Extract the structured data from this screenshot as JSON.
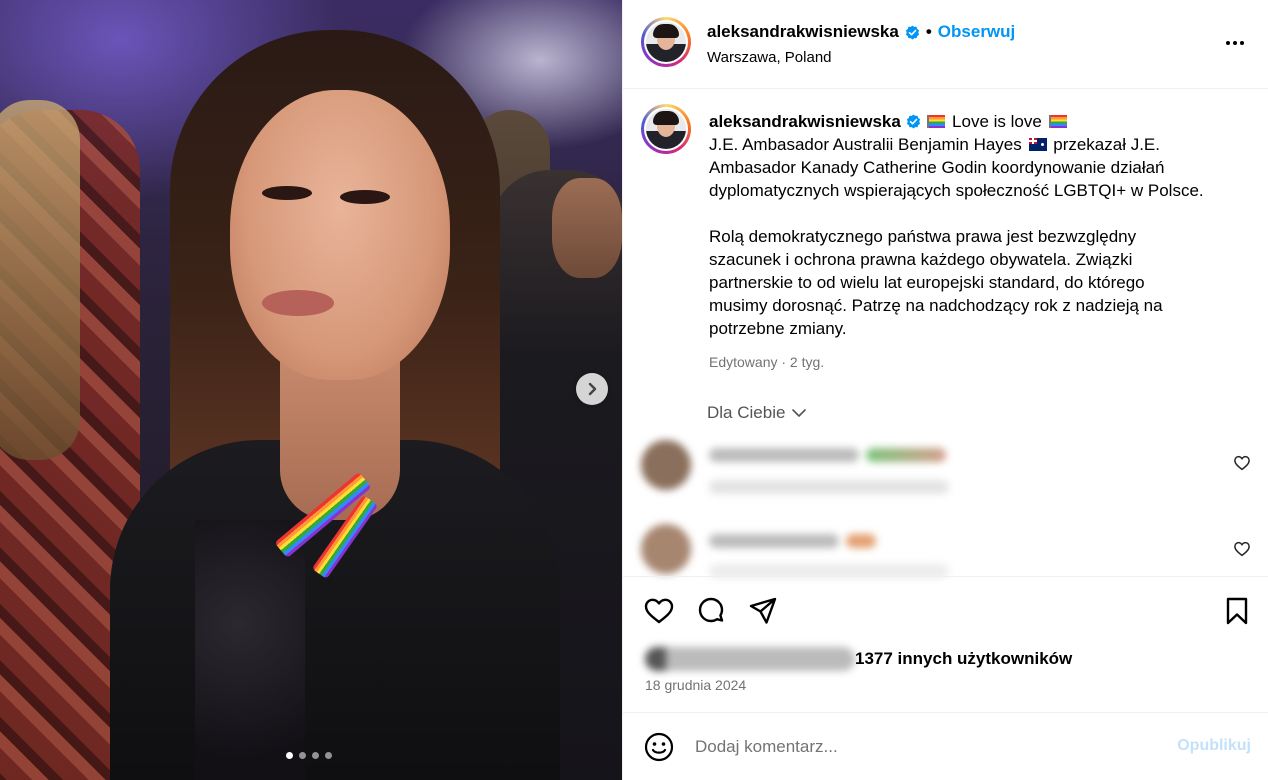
{
  "post": {
    "carousel": {
      "slide_count": 4,
      "active_index": 0
    },
    "header": {
      "username": "aleksandrakwisniewska",
      "separator": "•",
      "follow_label": "Obserwuj",
      "location": "Warszawa, Poland"
    },
    "caption": {
      "username": "aleksandrakwisniewska",
      "title": "Love is love",
      "line1": "J.E. Ambasador Australii Benjamin Hayes",
      "line1_after_flag": "przekazał J.E.",
      "line2": "Ambasador Kanady Catherine Godin koordynowanie działań",
      "line3": "dyplomatycznych wspierających społeczność LGBTQI+ w Polsce.",
      "para2_line1": "Rolą demokratycznego państwa prawa jest bezwzględny",
      "para2_line2": "szacunek i ochrona prawna każdego obywatela. Związki",
      "para2_line3": "partnerskie to od wielu lat europejski standard, do którego",
      "para2_line4": "musimy dorosnąć. Patrzę na nadchodzący rok z nadzieją na",
      "para2_line5": "potrzebne zmiany.",
      "edited": "Edytowany · 2 tyg."
    },
    "comments_filter": {
      "label": "Dla Ciebie"
    },
    "likes": {
      "text": "1377 innych użytkowników"
    },
    "date": "18 grudnia 2024",
    "comment_box": {
      "placeholder": "Dodaj komentarz...",
      "publish_label": "Opublikuj"
    },
    "icons": {
      "verified": "verified-badge-icon",
      "like": "heart-icon",
      "comment": "comment-icon",
      "share": "share-icon",
      "save": "bookmark-icon",
      "emoji": "emoji-icon",
      "more": "more-options-icon",
      "next": "chevron-right-icon"
    },
    "colors": {
      "accent": "#0095f6",
      "publish_disabled": "#c3e1fb",
      "verified": "#0095f6"
    }
  }
}
